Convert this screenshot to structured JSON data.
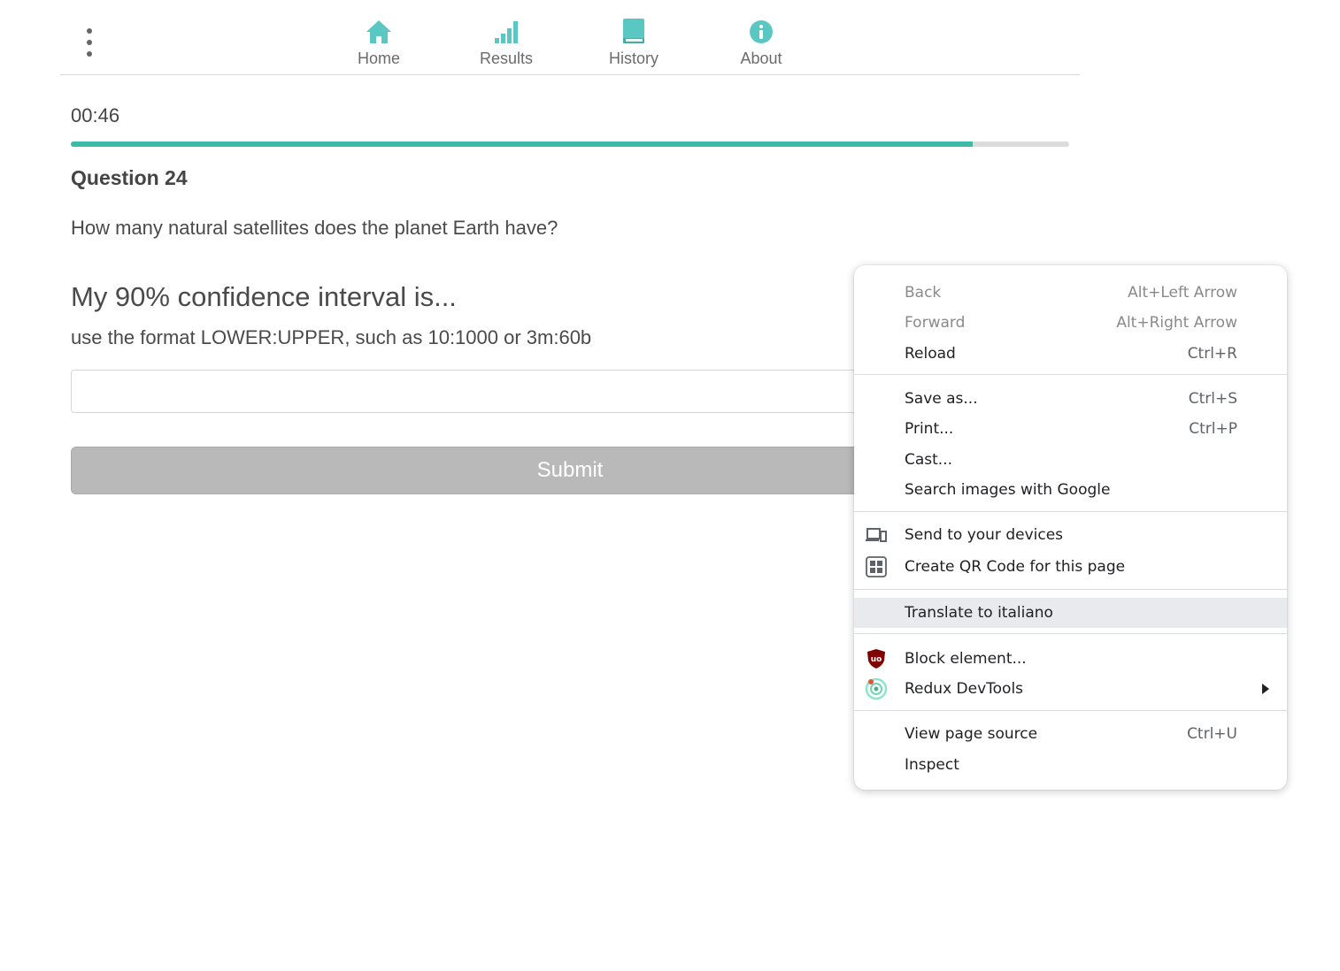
{
  "nav": {
    "items": [
      {
        "label": "Home",
        "icon": "home-icon"
      },
      {
        "label": "Results",
        "icon": "bar-chart-icon"
      },
      {
        "label": "History",
        "icon": "book-icon"
      },
      {
        "label": "About",
        "icon": "info-icon"
      }
    ],
    "accent_color": "#5bc7c2"
  },
  "quiz": {
    "timer": "00:46",
    "progress_fraction": 0.903,
    "question_title": "Question 24",
    "question_text": "How many natural satellites does the planet Earth have?",
    "ci_heading": "My 90% confidence interval is...",
    "ci_hint": "use the format LOWER:UPPER, such as 10:1000 or 3m:60b",
    "input_value": "",
    "submit_label": "Submit"
  },
  "context_menu": {
    "groups": [
      [
        {
          "label": "Back",
          "shortcut": "Alt+Left Arrow",
          "disabled": true
        },
        {
          "label": "Forward",
          "shortcut": "Alt+Right Arrow",
          "disabled": true
        },
        {
          "label": "Reload",
          "shortcut": "Ctrl+R"
        }
      ],
      [
        {
          "label": "Save as...",
          "shortcut": "Ctrl+S"
        },
        {
          "label": "Print...",
          "shortcut": "Ctrl+P"
        },
        {
          "label": "Cast..."
        },
        {
          "label": "Search images with Google"
        }
      ],
      [
        {
          "label": "Send to your devices",
          "icon": "send-to-devices-icon"
        },
        {
          "label": "Create QR Code for this page",
          "icon": "qr-code-icon"
        }
      ],
      [
        {
          "label": "Translate to italiano",
          "highlighted": true
        }
      ],
      [
        {
          "label": "Block element...",
          "icon": "ublock-origin-icon"
        },
        {
          "label": "Redux DevTools",
          "icon": "redux-devtools-icon",
          "submenu": true
        }
      ],
      [
        {
          "label": "View page source",
          "shortcut": "Ctrl+U"
        },
        {
          "label": "Inspect"
        }
      ]
    ]
  }
}
